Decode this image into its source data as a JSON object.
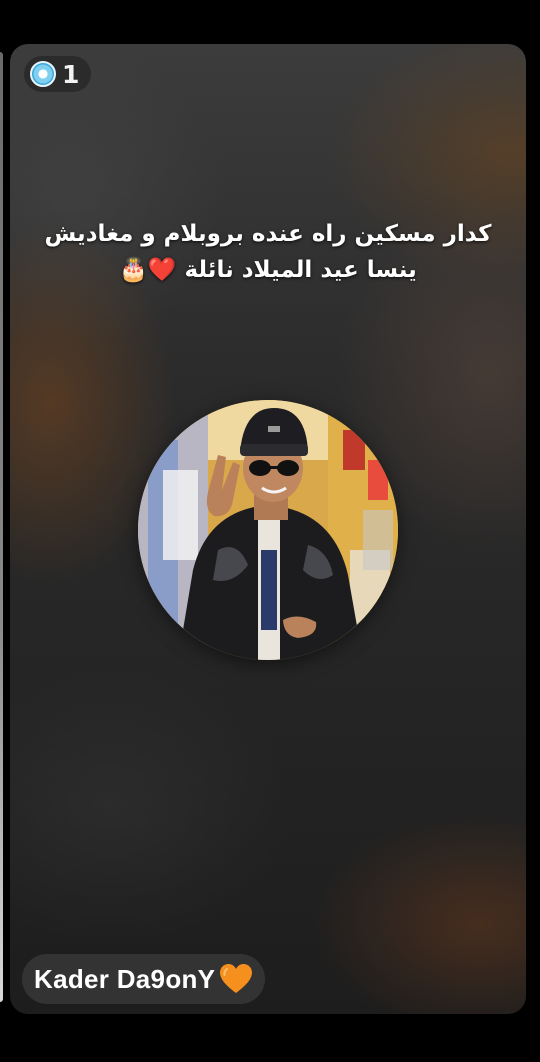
{
  "story": {
    "viewer_count": "1",
    "viewer_icon": "viewer-badge-icon",
    "caption_line1": "كدار مسكين راه عنده بروبلام و مغاديش",
    "caption_line2": "ينسا عيد الميلاد نائلة ❤️🎂",
    "avatar_icon": "profile-photo",
    "author_name": "Kader Da9onY",
    "author_emoji": "orange-heart-icon"
  },
  "colors": {
    "background": "#000000",
    "card": "#2b2b2b",
    "text": "#ffffff",
    "heart": "#f5901e"
  }
}
